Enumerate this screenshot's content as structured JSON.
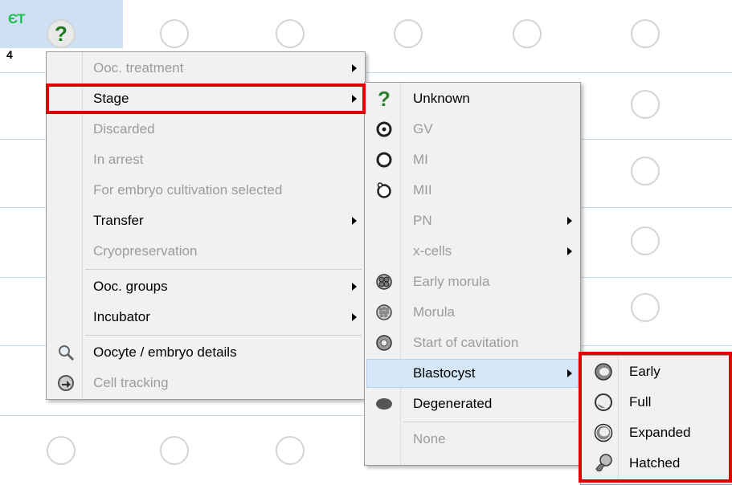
{
  "grid": {
    "et_label": "ЄT",
    "row_number": "4",
    "stage_glyph": "?"
  },
  "menu1": {
    "items": [
      {
        "label": "Ooc. treatment",
        "disabled": true
      },
      {
        "label": "Stage",
        "disabled": false
      },
      {
        "label": "Discarded",
        "disabled": true
      },
      {
        "label": "In arrest",
        "disabled": true
      },
      {
        "label": "For embryo cultivation selected",
        "disabled": true
      },
      {
        "label": "Transfer",
        "disabled": false
      },
      {
        "label": "Cryopreservation",
        "disabled": true
      },
      {
        "label": "Ooc. groups",
        "disabled": false
      },
      {
        "label": "Incubator",
        "disabled": false
      },
      {
        "label": "Oocyte / embryo details",
        "disabled": false,
        "icon": "magnifier-icon"
      },
      {
        "label": "Cell tracking",
        "disabled": true,
        "icon": "cell-tracking-icon"
      }
    ]
  },
  "menu2": {
    "items": [
      {
        "label": "Unknown",
        "icon": "question-mark-icon"
      },
      {
        "label": "GV",
        "disabled": true,
        "icon": "gv-oocyte-icon"
      },
      {
        "label": "MI",
        "disabled": true,
        "icon": "mi-oocyte-icon"
      },
      {
        "label": "MII",
        "disabled": true,
        "icon": "mii-oocyte-icon"
      },
      {
        "label": "PN",
        "disabled": true
      },
      {
        "label": "x-cells",
        "disabled": true
      },
      {
        "label": "Early morula",
        "disabled": true,
        "icon": "early-morula-icon"
      },
      {
        "label": "Morula",
        "disabled": true,
        "icon": "morula-icon"
      },
      {
        "label": "Start of cavitation",
        "disabled": true,
        "icon": "cavitation-icon"
      },
      {
        "label": "Blastocyst"
      },
      {
        "label": "Degenerated",
        "icon": "degenerated-icon"
      },
      {
        "label": "None",
        "disabled": true
      }
    ]
  },
  "menu3": {
    "items": [
      {
        "label": "Early",
        "icon": "blastocyst-early-icon"
      },
      {
        "label": "Full",
        "icon": "blastocyst-full-icon"
      },
      {
        "label": "Expanded",
        "icon": "blastocyst-expanded-icon"
      },
      {
        "label": "Hatched",
        "icon": "blastocyst-hatched-icon"
      }
    ]
  },
  "colors": {
    "highlight_box": "#e00000",
    "grid_line": "#c6dcec",
    "selected_cell": "#cfe0f4"
  }
}
